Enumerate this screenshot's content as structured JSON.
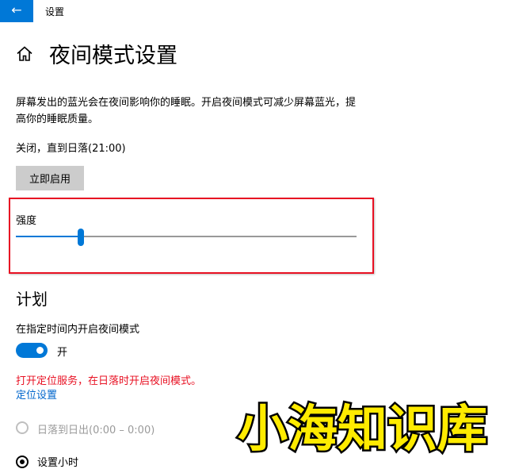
{
  "window": {
    "title": "设置",
    "back_icon": "←"
  },
  "page": {
    "title": "夜间模式设置",
    "home_icon": "home-icon"
  },
  "description": "屏幕发出的蓝光会在夜间影响你的睡眠。开启夜间模式可减少屏幕蓝光，提高你的睡眠质量。",
  "status": "关闭，直到日落(21:00)",
  "enable_button": "立即启用",
  "strength": {
    "label": "强度",
    "value_fraction": 0.19
  },
  "schedule": {
    "title": "计划",
    "toggle_label": "在指定时间内开启夜间模式",
    "toggle_state": "开",
    "warning": "打开定位服务，在日落时开启夜间模式。",
    "location_link": "定位设置",
    "options": [
      {
        "label": "日落到日出(0:00 – 0:00)",
        "selected": false,
        "enabled": false
      },
      {
        "label": "设置小时",
        "selected": true,
        "enabled": true
      }
    ]
  },
  "watermark": "小海知识库",
  "colors": {
    "accent": "#0078d7",
    "highlight_border": "#e81123",
    "warning": "#e81123",
    "link": "#0066cc",
    "watermark_fill": "#ffeb00"
  }
}
